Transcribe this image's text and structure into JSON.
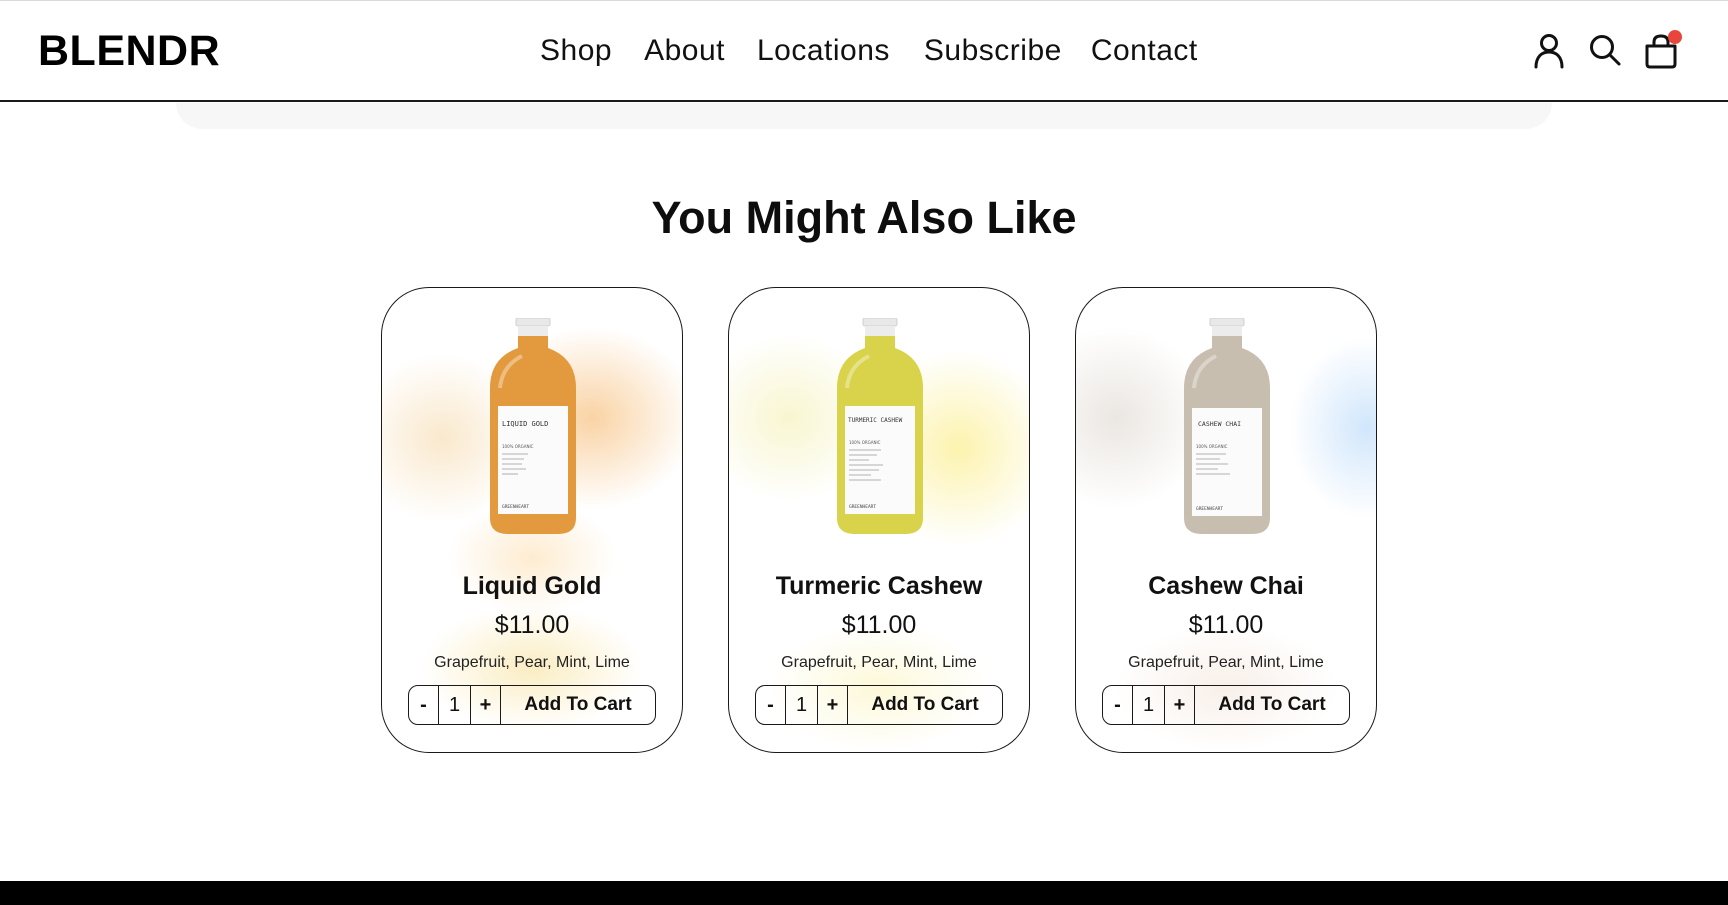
{
  "brand": {
    "logo": "BLENDR"
  },
  "nav": {
    "items": [
      {
        "label": "Shop"
      },
      {
        "label": "About"
      },
      {
        "label": "Locations"
      },
      {
        "label": "Subscribe"
      },
      {
        "label": "Contact"
      }
    ]
  },
  "header_icons": {
    "account": "user-icon",
    "search": "search-icon",
    "cart": "shopping-bag-icon",
    "cart_badge_color": "#e8453c"
  },
  "section": {
    "title": "You Might Also Like"
  },
  "products": [
    {
      "name": "Liquid Gold",
      "price": "$11.00",
      "ingredients": "Grapefruit, Pear, Mint, Lime",
      "quantity": "1",
      "minus": "-",
      "plus": "+",
      "add_label": "Add To Cart",
      "label_title": "LIQUID GOLD",
      "label_sub": "100% ORGANIC",
      "label_brand": "GREENHEART",
      "liquid_color": "#e39a3e",
      "accent": "#f2b35a"
    },
    {
      "name": "Turmeric Cashew",
      "price": "$11.00",
      "ingredients": "Grapefruit, Pear, Mint, Lime",
      "quantity": "1",
      "minus": "-",
      "plus": "+",
      "add_label": "Add To Cart",
      "label_title": "TURMERIC CASHEW",
      "label_sub": "100% ORGANIC",
      "label_brand": "GREENHEART",
      "liquid_color": "#d8d34a",
      "accent": "#f6e87a"
    },
    {
      "name": "Cashew Chai",
      "price": "$11.00",
      "ingredients": "Grapefruit, Pear, Mint, Lime",
      "quantity": "1",
      "minus": "-",
      "plus": "+",
      "add_label": "Add To Cart",
      "label_title": "CASHEW CHAI",
      "label_sub": "100% ORGANIC",
      "label_brand": "GREENHEART",
      "liquid_color": "#c8beb0",
      "accent": "#bcdcf7"
    }
  ]
}
